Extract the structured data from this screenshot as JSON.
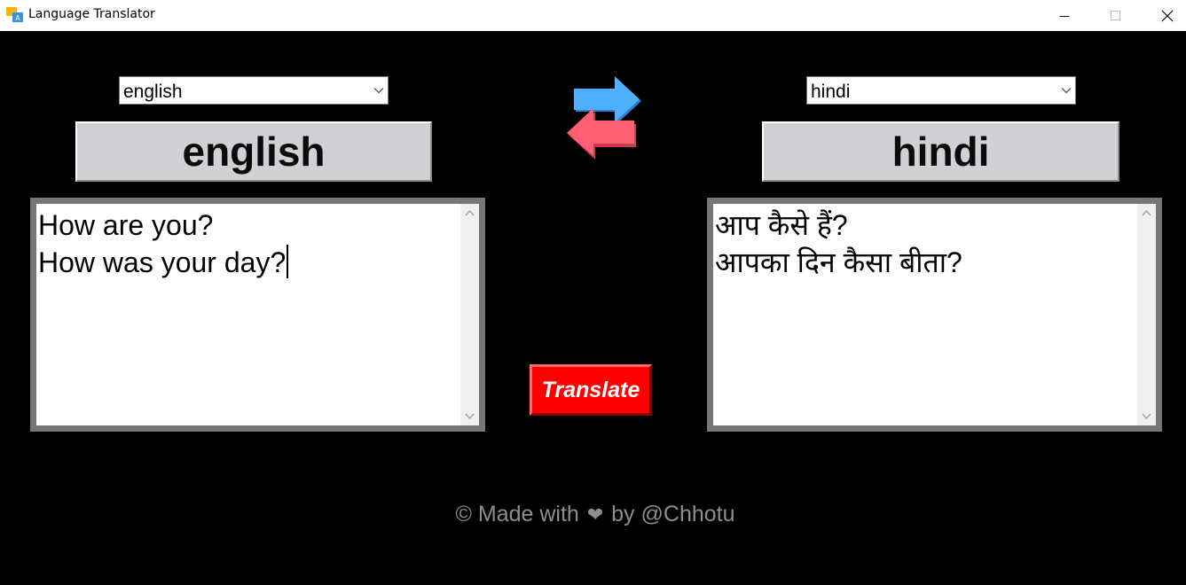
{
  "window": {
    "title": "Language Translator"
  },
  "source": {
    "selected_language": "english",
    "label": "english",
    "text": "How are you?\nHow was your day?"
  },
  "target": {
    "selected_language": "hindi",
    "label": "hindi",
    "text": "आप कैसे हैं?\nआपका दिन कैसा बीता?"
  },
  "actions": {
    "translate_label": "Translate",
    "swap_icon": "swap-arrows-icon"
  },
  "footer": {
    "prefix": "© Made with",
    "heart": "❤",
    "suffix": "by @Chhotu"
  },
  "colors": {
    "background": "#000000",
    "translate_button": "#ff0000",
    "label_bg": "#d0d0d5",
    "swap_blue": "#4da6ff",
    "swap_red": "#ff5a6e",
    "footer_text": "#8e8e8e"
  }
}
